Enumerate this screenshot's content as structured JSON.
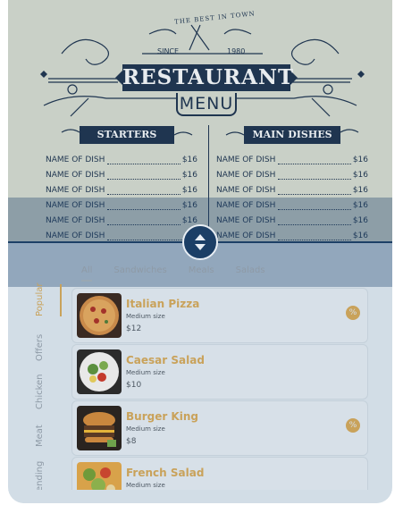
{
  "poster": {
    "tagline": "THE BEST IN TOWN",
    "since_label": "SINCE",
    "year": "1980",
    "title": "RESTAURANT",
    "subtitle": "MENU",
    "sections": [
      {
        "heading": "STARTERS",
        "dishes": [
          {
            "name": "NAME OF DISH",
            "price": "$16"
          },
          {
            "name": "NAME OF DISH",
            "price": "$16"
          },
          {
            "name": "NAME OF DISH",
            "price": "$16"
          },
          {
            "name": "NAME OF DISH",
            "price": "$16"
          },
          {
            "name": "NAME OF DISH",
            "price": "$16"
          },
          {
            "name": "NAME OF DISH",
            "price": "$1"
          }
        ]
      },
      {
        "heading": "MAIN DISHES",
        "dishes": [
          {
            "name": "NAME OF DISH",
            "price": "$16"
          },
          {
            "name": "NAME OF DISH",
            "price": "$16"
          },
          {
            "name": "NAME OF DISH",
            "price": "$16"
          },
          {
            "name": "NAME OF DISH",
            "price": "$16"
          },
          {
            "name": "NAME OF DISH",
            "price": "$16"
          },
          {
            "name": "NAME OF DISH",
            "price": "$16"
          }
        ]
      }
    ]
  },
  "tabs": [
    "All",
    "Sandwiches",
    "Meals",
    "Salads"
  ],
  "side_nav": [
    "Popular",
    "Offers",
    "Chicken",
    "Meat",
    "ending"
  ],
  "items": [
    {
      "name": "Italian Pizza",
      "size": "Medium size",
      "price": "$12",
      "badge": "%"
    },
    {
      "name": "Caesar Salad",
      "size": "Medium size",
      "price": "$10",
      "badge": ""
    },
    {
      "name": "Burger King",
      "size": "Medium size",
      "price": "$8",
      "badge": "%"
    },
    {
      "name": "French Salad",
      "size": "Medium size",
      "price": "",
      "badge": ""
    }
  ],
  "colors": {
    "accent": "#c9a25a",
    "navy": "#1f3550",
    "overlay": "#1c3f66"
  }
}
